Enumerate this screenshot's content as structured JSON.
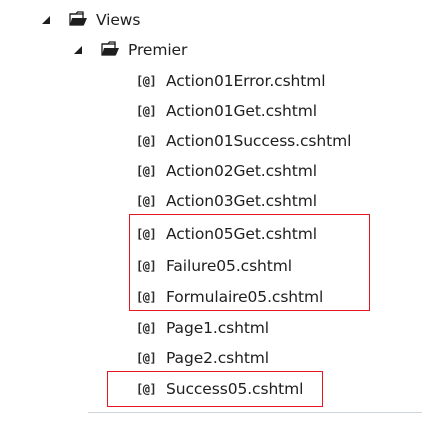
{
  "tree": {
    "root": {
      "label": "Views",
      "icon": "folder-open-icon",
      "expanded": true,
      "children": [
        {
          "label": "Premier",
          "icon": "folder-open-icon",
          "expanded": true,
          "files": [
            {
              "icon_text": "[@]",
              "label": "Action01Error.cshtml"
            },
            {
              "icon_text": "[@]",
              "label": "Action01Get.cshtml"
            },
            {
              "icon_text": "[@]",
              "label": "Action01Success.cshtml"
            },
            {
              "icon_text": "[@]",
              "label": "Action02Get.cshtml"
            },
            {
              "icon_text": "[@]",
              "label": "Action03Get.cshtml"
            },
            {
              "icon_text": "[@]",
              "label": "Action05Get.cshtml"
            },
            {
              "icon_text": "[@]",
              "label": "Failure05.cshtml"
            },
            {
              "icon_text": "[@]",
              "label": "Formulaire05.cshtml"
            },
            {
              "icon_text": "[@]",
              "label": "Page1.cshtml"
            },
            {
              "icon_text": "[@]",
              "label": "Page2.cshtml"
            },
            {
              "icon_text": "[@]",
              "label": "Success05.cshtml"
            }
          ]
        }
      ]
    }
  },
  "colors": {
    "highlight": "#e8161e",
    "text": "#1e1e1e",
    "icon": "#2b2b2b",
    "separator": "#cfd5dc"
  }
}
